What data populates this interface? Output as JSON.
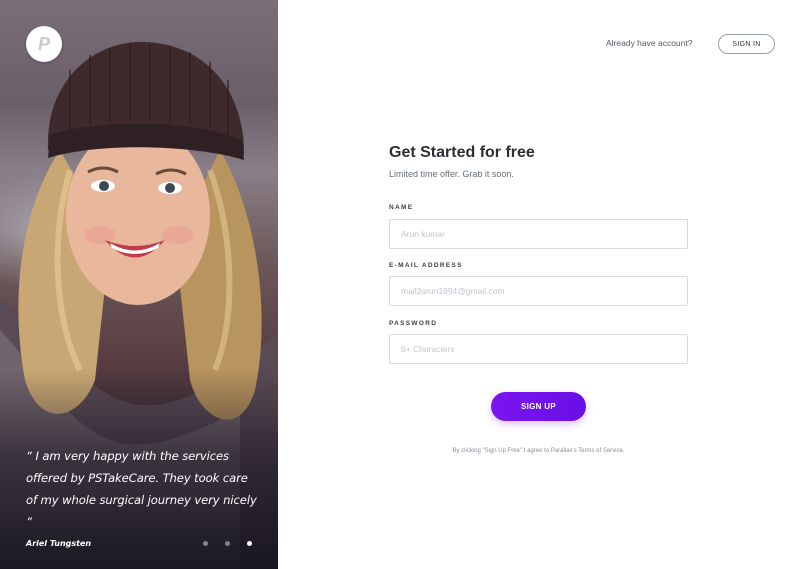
{
  "testimonial": {
    "logo_letter": "P",
    "quote": "“ I am very happy with the services offered by PSTakeCare. They took care of my whole surgical journey very nicely ”",
    "author": "Ariel Tungsten",
    "slides_total": 3,
    "slide_active": 3
  },
  "header": {
    "already_text": "Already have account?",
    "signin_label": "SIGN IN"
  },
  "form": {
    "title": "Get Started for free",
    "subtitle": "Limited time offer. Grab it soon.",
    "fields": [
      {
        "label": "NAME",
        "placeholder": "Arun kumar",
        "value": ""
      },
      {
        "label": "E-MAIL ADDRESS",
        "placeholder": "mail2arun1994@gmail.com",
        "value": ""
      },
      {
        "label": "PASSWORD",
        "placeholder": "6+ Characters",
        "value": ""
      }
    ],
    "submit_label": "SIGN UP",
    "terms": "By clicking \"Sign Up Free\" I agree to Parallax's Terms of Service."
  },
  "colors": {
    "accent": "#6a0ee6",
    "panel_dark": "#24202a"
  }
}
